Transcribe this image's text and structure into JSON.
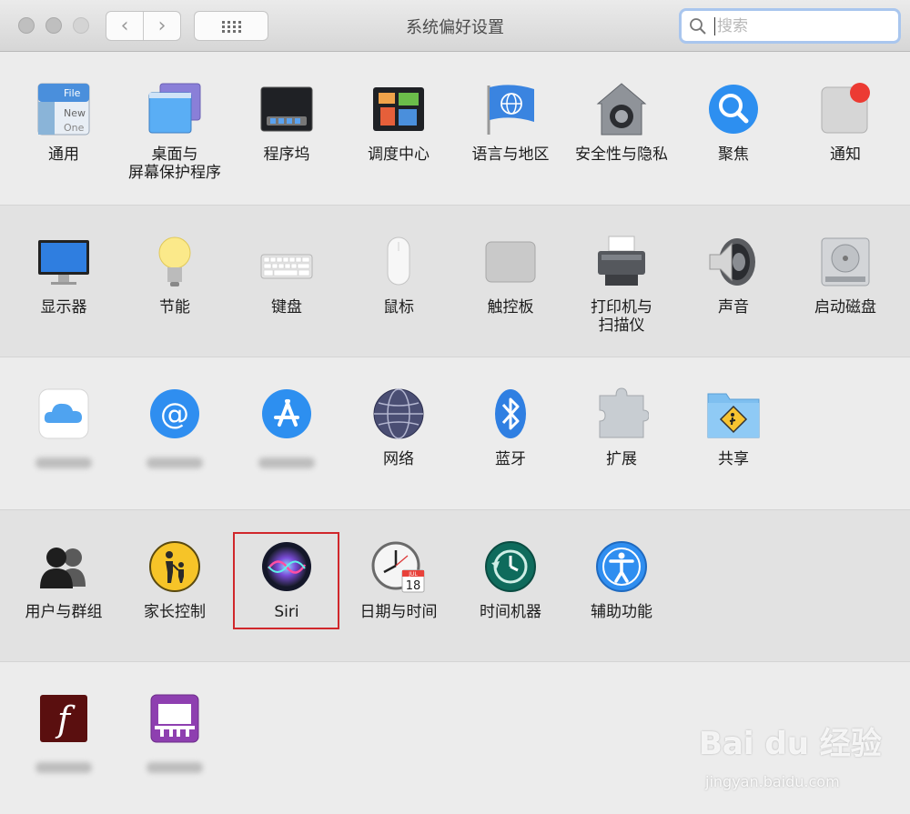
{
  "window": {
    "title": "系统偏好设置"
  },
  "toolbar": {
    "back": "‹",
    "forward": "›",
    "search_placeholder": "搜索"
  },
  "rows": [
    [
      {
        "label": "通用",
        "icon": "general-icon"
      },
      {
        "label": "桌面与\n屏幕保护程序",
        "icon": "desktop-screensaver-icon"
      },
      {
        "label": "程序坞",
        "icon": "dock-icon"
      },
      {
        "label": "调度中心",
        "icon": "mission-control-icon"
      },
      {
        "label": "语言与地区",
        "icon": "language-region-icon"
      },
      {
        "label": "安全性与隐私",
        "icon": "security-privacy-icon"
      },
      {
        "label": "聚焦",
        "icon": "spotlight-icon"
      },
      {
        "label": "通知",
        "icon": "notifications-icon"
      }
    ],
    [
      {
        "label": "显示器",
        "icon": "displays-icon"
      },
      {
        "label": "节能",
        "icon": "energy-saver-icon"
      },
      {
        "label": "键盘",
        "icon": "keyboard-icon"
      },
      {
        "label": "鼠标",
        "icon": "mouse-icon"
      },
      {
        "label": "触控板",
        "icon": "trackpad-icon"
      },
      {
        "label": "打印机与\n扫描仪",
        "icon": "printers-scanners-icon"
      },
      {
        "label": "声音",
        "icon": "sound-icon"
      },
      {
        "label": "启动磁盘",
        "icon": "startup-disk-icon"
      }
    ],
    [
      {
        "label": "",
        "icon": "icloud-icon"
      },
      {
        "label": "",
        "icon": "internet-accounts-icon"
      },
      {
        "label": "",
        "icon": "app-store-icon"
      },
      {
        "label": "网络",
        "icon": "network-icon"
      },
      {
        "label": "蓝牙",
        "icon": "bluetooth-icon"
      },
      {
        "label": "扩展",
        "icon": "extensions-icon"
      },
      {
        "label": "共享",
        "icon": "sharing-icon"
      }
    ],
    [
      {
        "label": "用户与群组",
        "icon": "users-groups-icon"
      },
      {
        "label": "家长控制",
        "icon": "parental-controls-icon"
      },
      {
        "label": "Siri",
        "icon": "siri-icon"
      },
      {
        "label": "日期与时间",
        "icon": "date-time-icon"
      },
      {
        "label": "时间机器",
        "icon": "time-machine-icon"
      },
      {
        "label": "辅助功能",
        "icon": "accessibility-icon"
      }
    ],
    [
      {
        "label": "",
        "icon": "flash-player-icon"
      },
      {
        "label": "",
        "icon": "presentation-icon"
      }
    ]
  ],
  "date_icon_month": "JUL",
  "date_icon_day": "18",
  "watermark": {
    "brand": "Bai du 经验",
    "url": "jingyan.baidu.com"
  }
}
